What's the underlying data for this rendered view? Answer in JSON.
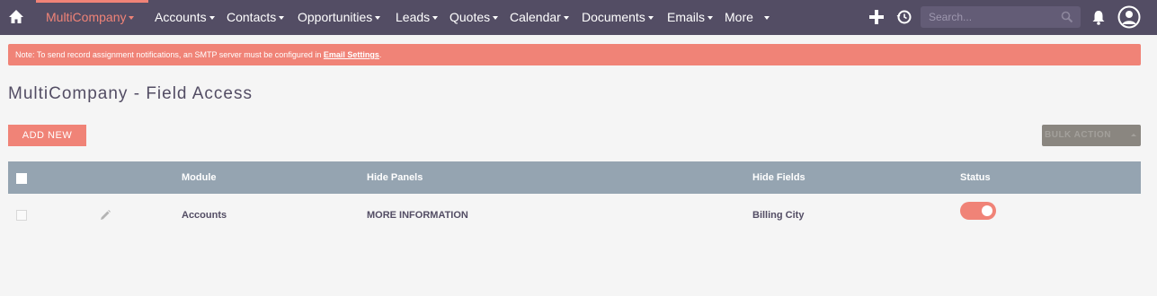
{
  "nav": {
    "items": [
      {
        "label": "MultiCompany"
      },
      {
        "label": "Accounts"
      },
      {
        "label": "Contacts"
      },
      {
        "label": "Opportunities"
      },
      {
        "label": "Leads"
      },
      {
        "label": "Quotes"
      },
      {
        "label": "Calendar"
      },
      {
        "label": "Documents"
      },
      {
        "label": "Emails"
      },
      {
        "label": "More"
      }
    ],
    "search_placeholder": "Search...",
    "icons": [
      "home-icon",
      "plus-icon",
      "history-icon",
      "search-icon",
      "bell-icon",
      "user-icon"
    ]
  },
  "alert": {
    "text": "Note: To send record assignment notifications, an SMTP server must be configured in ",
    "link": "Email Settings",
    "suffix": "."
  },
  "page": {
    "title": "MultiCompany - Field Access",
    "add_new": "ADD NEW",
    "bulk_action": "BULK ACTION"
  },
  "table": {
    "headers": {
      "module": "Module",
      "hide_panels": "Hide Panels",
      "hide_fields": "Hide Fields",
      "status": "Status"
    },
    "rows": [
      {
        "module": "Accounts",
        "hide_panels": "MORE INFORMATION",
        "hide_fields": "Billing City",
        "status": "on"
      }
    ]
  },
  "colors": {
    "accent": "#f08377",
    "nav_bg": "#534d64",
    "table_header": "#95a4b1"
  }
}
